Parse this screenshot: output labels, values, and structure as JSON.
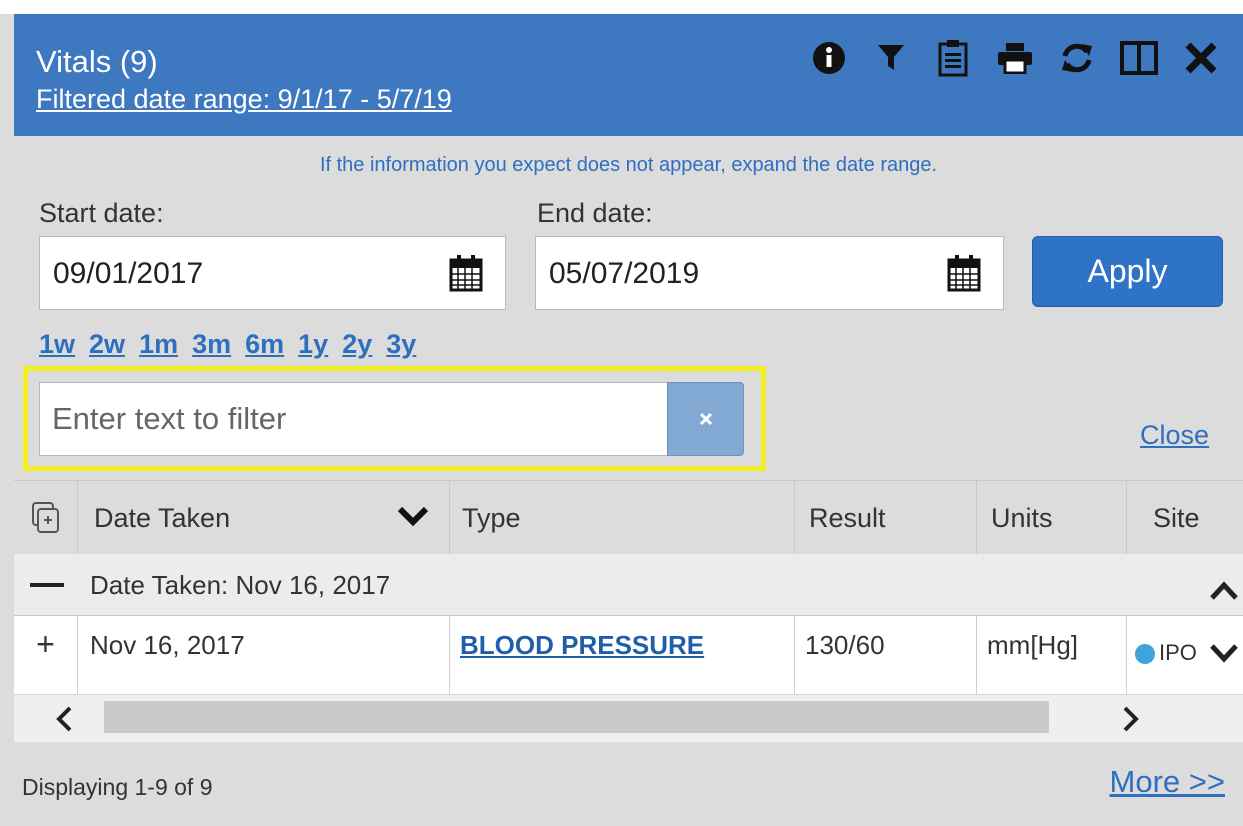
{
  "header": {
    "title": "Vitals (9)",
    "filtered_range": "Filtered date range: 9/1/17 - 5/7/19",
    "toolbar_icons": [
      "info-icon",
      "filter-icon",
      "clipboard-icon",
      "print-icon",
      "refresh-icon",
      "maximize-icon",
      "close-icon"
    ]
  },
  "filter": {
    "hint": "If the information you expect does not appear, expand the date range.",
    "start_label": "Start date:",
    "start_value": "09/01/2017",
    "end_label": "End date:",
    "end_value": "05/07/2019",
    "apply_label": "Apply",
    "quick_ranges": [
      "1w",
      "2w",
      "1m",
      "3m",
      "6m",
      "1y",
      "2y",
      "3y"
    ],
    "text_filter_placeholder": "Enter text to filter",
    "close_label": "Close"
  },
  "grid": {
    "columns": {
      "date": "Date Taken",
      "type": "Type",
      "result": "Result",
      "units": "Units",
      "site": "Site"
    },
    "group_label": "Date Taken:  Nov 16, 2017",
    "rows": [
      {
        "expand": "+",
        "date": "Nov 16, 2017",
        "type": "BLOOD PRESSURE",
        "result": "130/60",
        "units": "mm[Hg]",
        "site": "IPO"
      }
    ]
  },
  "footer": {
    "display_count": "Displaying 1-9 of 9",
    "more_label": "More >>"
  },
  "colors": {
    "header_bg": "#3e78c1",
    "panel_bg": "#dcdcdc",
    "link_blue": "#2f6fbf",
    "apply_bg": "#2e73c6",
    "highlight": "#f3ee1f",
    "site_dot": "#41a3dc"
  }
}
